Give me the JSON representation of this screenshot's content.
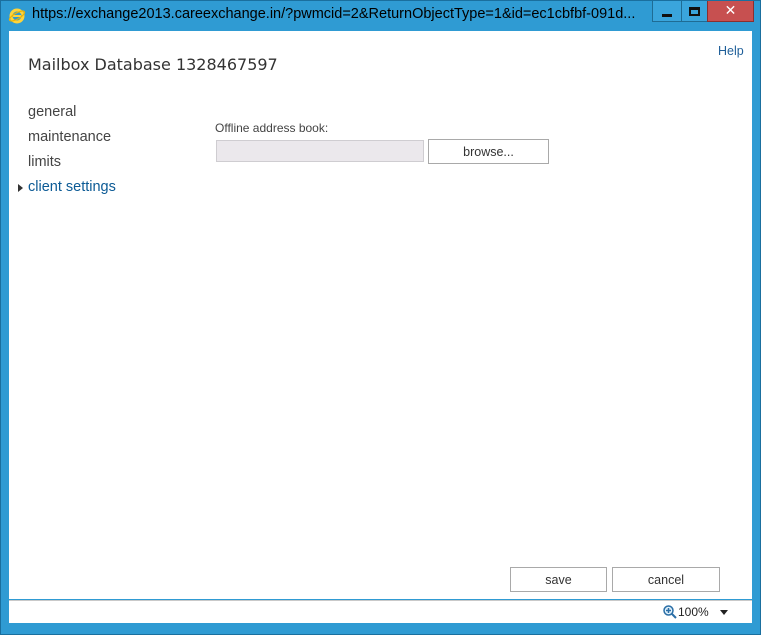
{
  "window": {
    "title": "https://exchange2013.careexchange.in/?pwmcid=2&ReturnObjectType=1&id=ec1cbfbf-091d...",
    "close_label": "✕"
  },
  "header": {
    "help_label": "Help",
    "page_title": "Mailbox Database 1328467597"
  },
  "nav": {
    "items": [
      {
        "label": "general"
      },
      {
        "label": "maintenance"
      },
      {
        "label": "limits"
      },
      {
        "label": "client settings"
      }
    ],
    "active": "client settings"
  },
  "form": {
    "oab_label": "Offline address book:",
    "oab_value": "",
    "browse_label": "browse..."
  },
  "footer": {
    "save_label": "save",
    "cancel_label": "cancel"
  },
  "statusbar": {
    "zoom": "100%"
  },
  "colors": {
    "titlebar": "#2f9bd3",
    "link": "#1f5f99",
    "close": "#c75050"
  }
}
